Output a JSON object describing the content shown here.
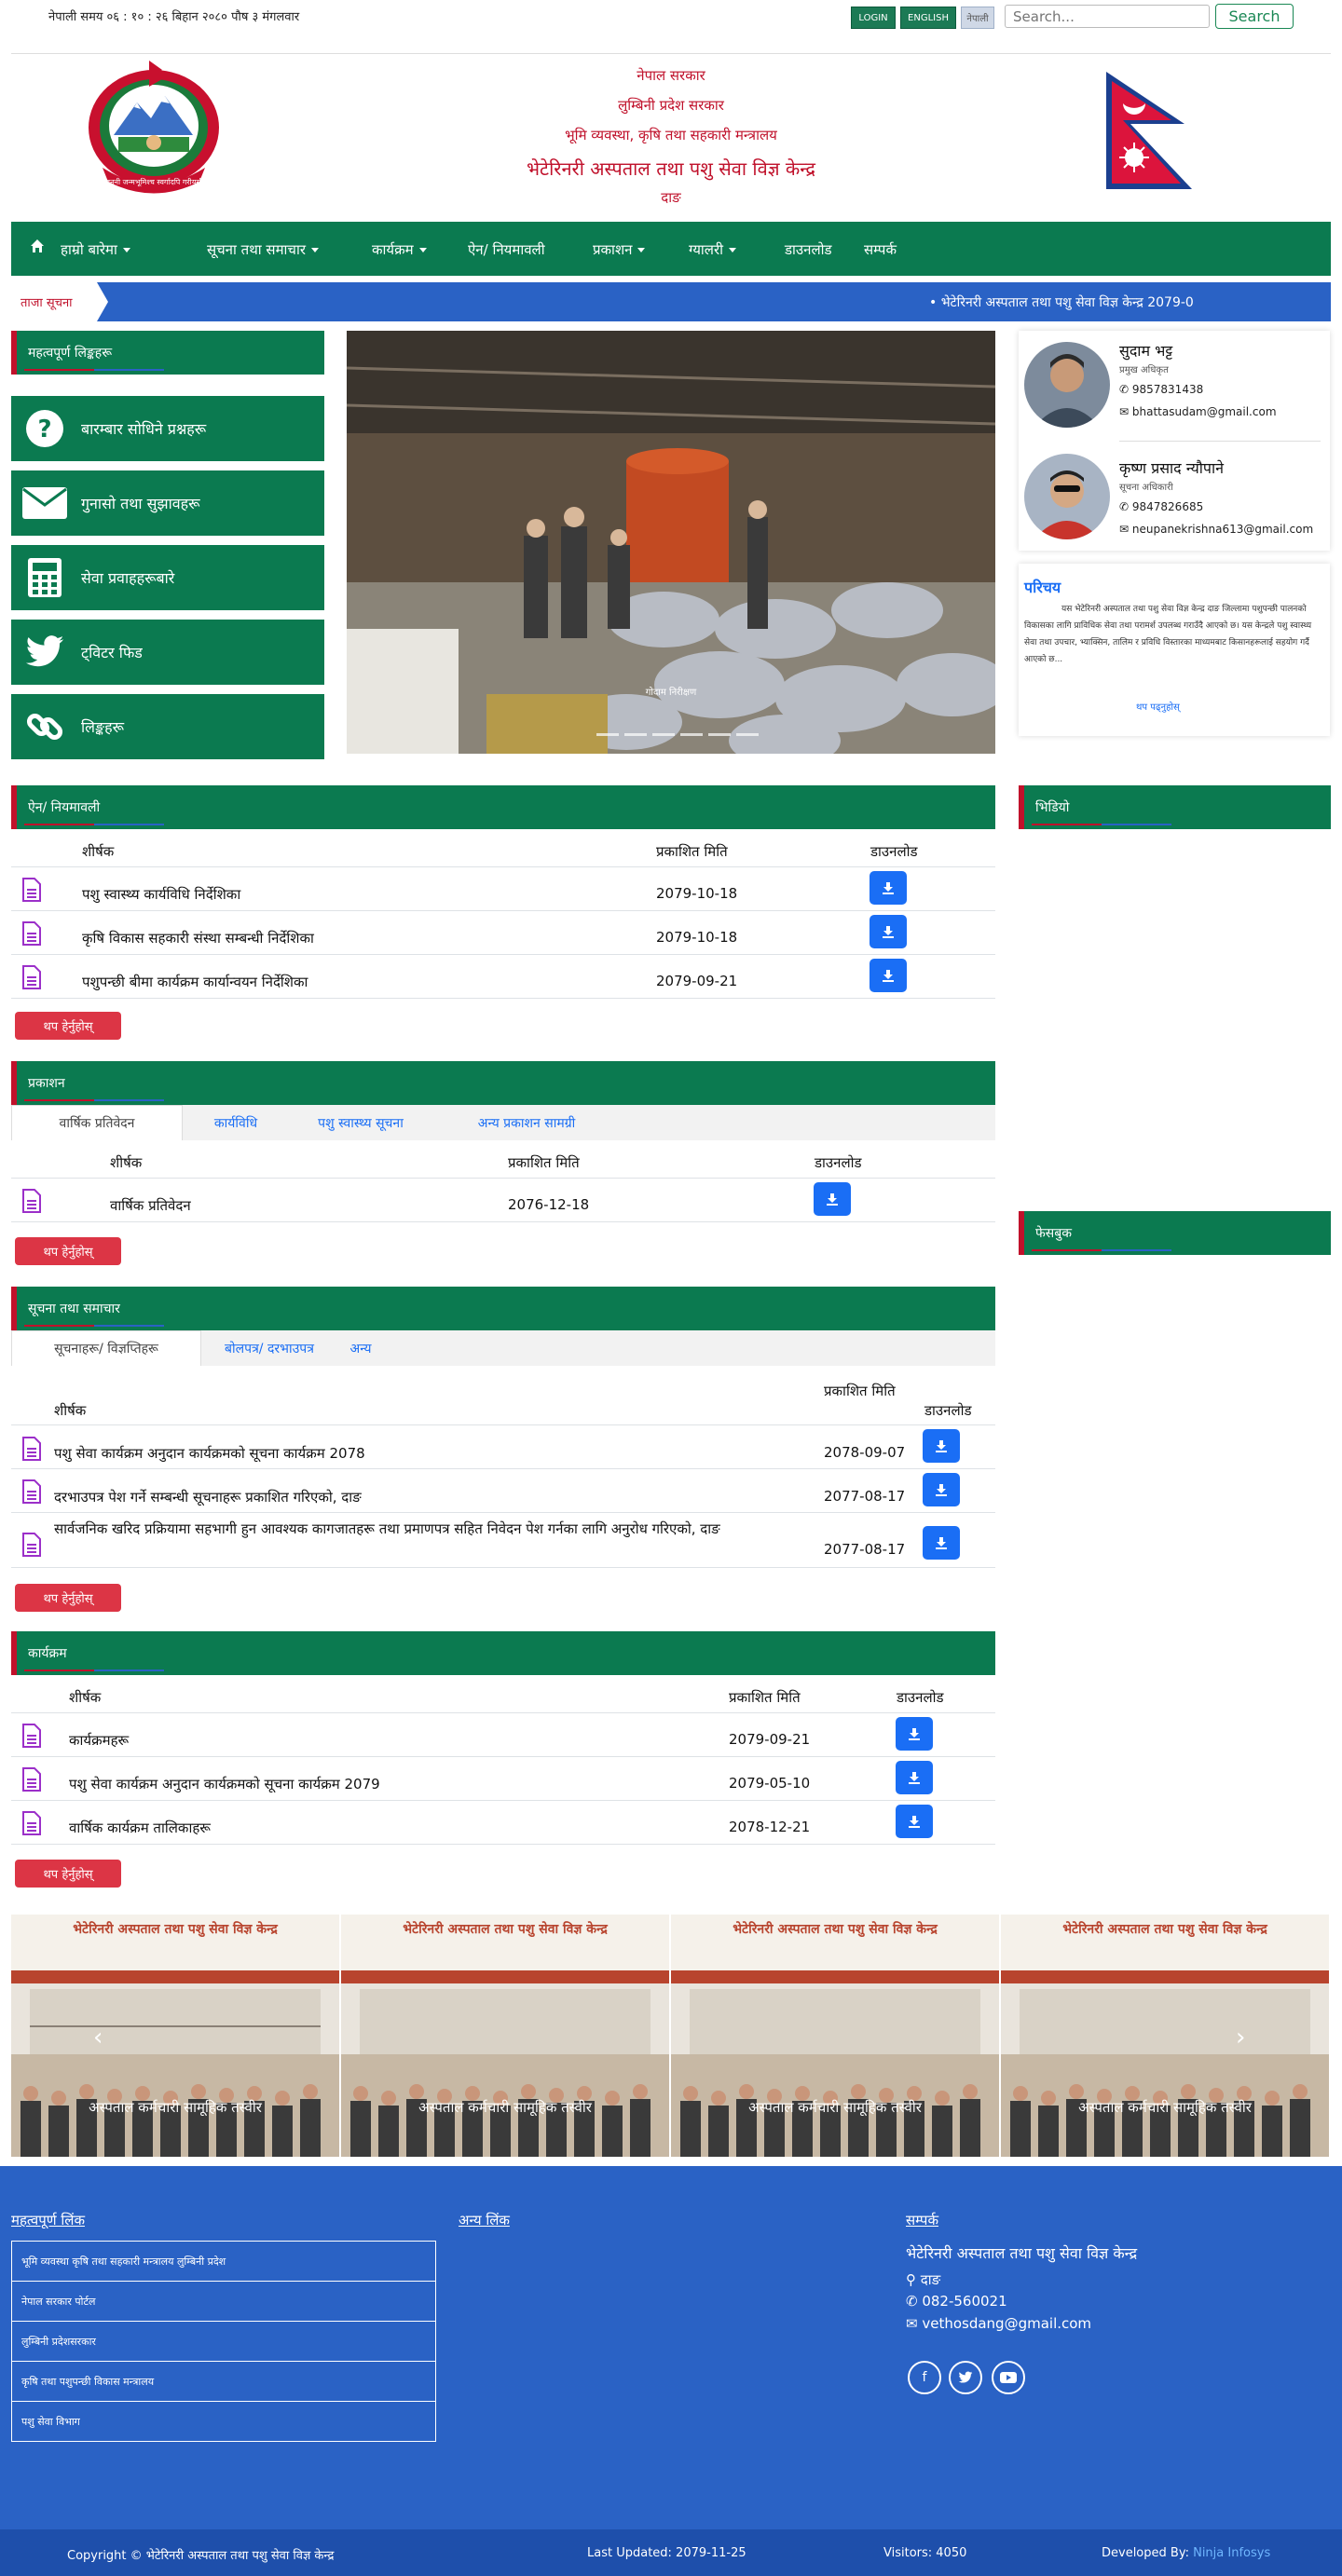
{
  "topbar": {
    "time": "नेपाली समय ०६ : १० : २६ बिहान    २०८० पौष ३ मंगलवार",
    "login": "LOGIN",
    "english": "ENGLISH",
    "nepali": "नेपाली",
    "search_placeholder": "Search...",
    "search_button": "Search"
  },
  "header": {
    "line1": "नेपाल सरकार",
    "line2": "लुम्बिनी प्रदेश सरकार",
    "line3": "भूमि व्यवस्था, कृषि तथा सहकारी मन्त्रालय",
    "line4": "भेटेरिनरी अस्पताल तथा पशु सेवा विज्ञ केन्द्र",
    "line5": "दाङ"
  },
  "nav": {
    "home_icon": "home-icon",
    "items": [
      {
        "label": "हाम्रो बारेमा",
        "dropdown": true
      },
      {
        "label": "सूचना तथा समाचार",
        "dropdown": true
      },
      {
        "label": "कार्यक्रम",
        "dropdown": true
      },
      {
        "label": "ऐन/ नियमावली",
        "dropdown": false
      },
      {
        "label": "प्रकाशन",
        "dropdown": true
      },
      {
        "label": "ग्यालरी",
        "dropdown": true
      },
      {
        "label": "डाउनलोड",
        "dropdown": false
      },
      {
        "label": "सम्पर्क",
        "dropdown": false
      }
    ]
  },
  "ticker": {
    "label": "ताजा सूचना",
    "text": "•  भेटेरिनरी अस्पताल तथा पशु सेवा विज्ञ केन्द्र 2079-0"
  },
  "left_panel": {
    "title": "महत्वपूर्ण लिङ्कहरू",
    "links": [
      {
        "icon": "question-icon",
        "label": "बारम्बार सोधिने प्रश्नहरू"
      },
      {
        "icon": "envelope-icon",
        "label": "गुनासो तथा सुझावहरू"
      },
      {
        "icon": "calculator-icon",
        "label": "सेवा प्रवाहहरूबारे"
      },
      {
        "icon": "twitter-icon",
        "label": "ट्विटर फिड"
      },
      {
        "icon": "link-icon",
        "label": "लिङ्कहरू"
      }
    ]
  },
  "slider": {
    "caption": "गोदाम निरीक्षण"
  },
  "staff": [
    {
      "name": "सुदाम भट्ट",
      "role": "प्रमुख अधिकृत",
      "phone": "9857831438",
      "email": "bhattasudam@gmail.com"
    },
    {
      "name": "कृष्ण प्रसाद न्यौपाने",
      "role": "सूचना अधिकारी",
      "phone": "9847826685",
      "email": "neupanekrishna613@gmail.com"
    }
  ],
  "intro": {
    "title": "परिचय",
    "text": "यस भेटेरिनरी अस्पताल तथा पशु सेवा विज्ञ केन्द्र दाङ जिल्लामा पशुपन्छी पालनको विकासका लागि प्राविधिक सेवा तथा परामर्श उपलब्ध गराउँदै आएको छ। यस केन्द्रले पशु स्वास्थ्य सेवा तथा उपचार, भ्याक्सिन, तालिम र प्रविधि विस्तारका माध्यमबाट किसानहरूलाई सहयोग गर्दै आएको छ...",
    "more": "थप पढ्नुहोस्"
  },
  "acts": {
    "title": "ऐन/ नियमावली",
    "headers": [
      "शीर्षक",
      "प्रकाशित मिति",
      "डाउनलोड"
    ],
    "rows": [
      {
        "title": "पशु स्वास्थ्य कार्यविधि निर्देशिका",
        "date": "2079-10-18"
      },
      {
        "title": "कृषि विकास सहकारी संस्था सम्बन्धी निर्देशिका",
        "date": "2079-10-18"
      },
      {
        "title": "पशुपन्छी बीमा कार्यक्रम कार्यान्वयन निर्देशिका",
        "date": "2079-09-21"
      }
    ],
    "more": "थप हेर्नुहोस्"
  },
  "publications": {
    "title": "प्रकाशन",
    "tabs": [
      "वार्षिक प्रतिवेदन",
      "कार्यविधि",
      "पशु स्वास्थ्य सूचना",
      "अन्य प्रकाशन सामग्री"
    ],
    "headers": [
      "शीर्षक",
      "प्रकाशित मिति",
      "डाउनलोड"
    ],
    "rows": [
      {
        "title": "वार्षिक प्रतिवेदन",
        "date": "2076-12-18"
      }
    ],
    "more": "थप हेर्नुहोस्"
  },
  "notices": {
    "title": "सूचना तथा समाचार",
    "tabs": [
      "सूचनाहरू/ विज्ञप्तिहरू",
      "बोलपत्र/ दरभाउपत्र",
      "अन्य"
    ],
    "headers": [
      "शीर्षक",
      "प्रकाशित मिति",
      "डाउनलोड"
    ],
    "rows": [
      {
        "title": "पशु सेवा कार्यक्रम अनुदान कार्यक्रमको सूचना कार्यक्रम 2078",
        "date": "2078-09-07"
      },
      {
        "title": "दरभाउपत्र पेश गर्ने सम्बन्धी सूचनाहरू प्रकाशित गरिएको, दाङ",
        "date": "2077-08-17"
      },
      {
        "title": "सार्वजनिक खरिद प्रक्रियामा सहभागी हुन आवश्यक कागजातहरू तथा प्रमाणपत्र सहित निवेदन पेश गर्नका लागि अनुरोध गरिएको, दाङ",
        "date": "2077-08-17"
      }
    ],
    "more": "थप हेर्नुहोस्"
  },
  "programs": {
    "title": "कार्यक्रम",
    "headers": [
      "शीर्षक",
      "प्रकाशित मिति",
      "डाउनलोड"
    ],
    "rows": [
      {
        "title": "कार्यक्रमहरू",
        "date": "2079-09-21"
      },
      {
        "title": "पशु सेवा कार्यक्रम अनुदान कार्यक्रमको सूचना कार्यक्रम 2079",
        "date": "2079-05-10"
      },
      {
        "title": "वार्षिक कार्यक्रम तालिकाहरू",
        "date": "2078-12-21"
      }
    ],
    "more": "थप हेर्नुहोस्"
  },
  "right_panel": {
    "sec1": "भिडियो",
    "sec2": "फेसबुक"
  },
  "gallery": {
    "sign": "भेटेरिनरी अस्पताल तथा पशु सेवा विज्ञ केन्द्र",
    "caption": "अस्पताल कर्मचारी सामूहिक तस्वीर"
  },
  "footer": {
    "col1_title": "महत्वपूर्ण लिंक",
    "col1_links": [
      "भूमि व्यवस्था कृषि तथा सहकारी मन्त्रालय लुम्बिनी प्रदेश",
      "नेपाल सरकार पोर्टल",
      "लुम्बिनी प्रदेशसरकार",
      "कृषि तथा पशुपन्छी विकास मन्त्रालय",
      "पशु सेवा विभाग"
    ],
    "col2_title": "अन्य लिंक",
    "col3_title": "सम्पर्क",
    "org": "भेटेरिनरी अस्पताल तथा पशु सेवा विज्ञ केन्द्र",
    "address": "दाङ",
    "phone": "082-560021",
    "email": "vethosdang@gmail.com",
    "copyright": "Copyright © भेटेरिनरी अस्पताल तथा पशु सेवा विज्ञ केन्द्र",
    "last_updated": "Last Updated: 2079-11-25",
    "visitors": "Visitors: 4050",
    "developed_by": "Developed By:",
    "developer": "Ninja Infosys"
  },
  "colors": {
    "green": "#0b7a50",
    "blue": "#2a62c5",
    "red": "#c0112b",
    "download": "#1a6ef5"
  }
}
